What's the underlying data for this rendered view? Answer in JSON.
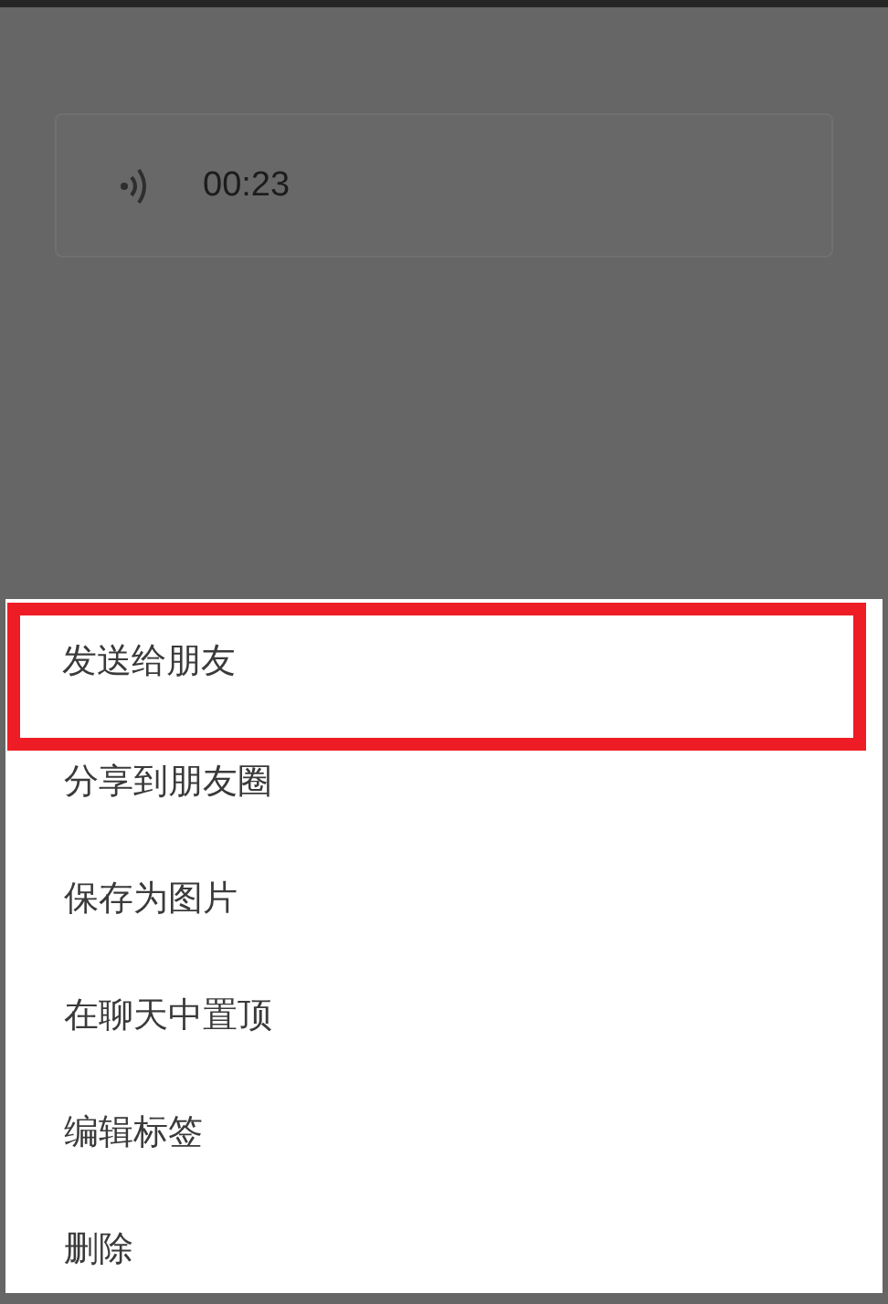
{
  "voice_message": {
    "duration": "00:23"
  },
  "menu": [
    {
      "label": "发送给朋友",
      "highlighted": true
    },
    {
      "label": "分享到朋友圈",
      "highlighted": false
    },
    {
      "label": "保存为图片",
      "highlighted": false
    },
    {
      "label": "在聊天中置顶",
      "highlighted": false
    },
    {
      "label": "编辑标签",
      "highlighted": false
    },
    {
      "label": "删除",
      "highlighted": false
    }
  ]
}
